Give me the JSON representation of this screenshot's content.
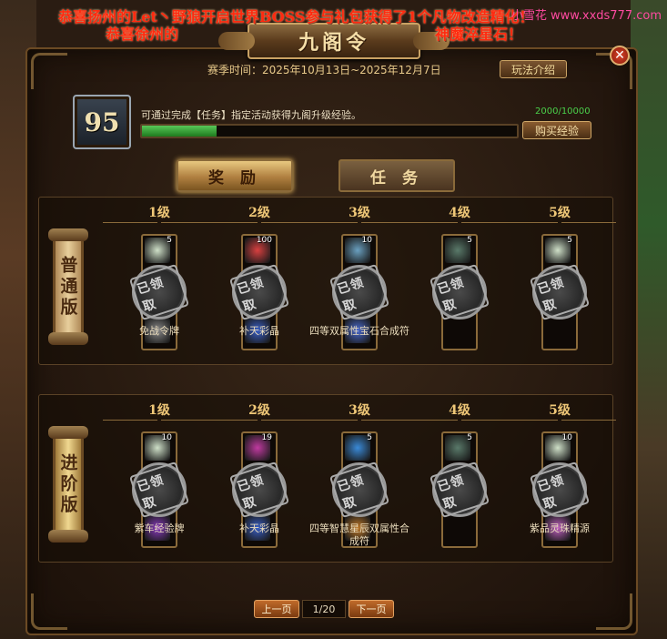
{
  "broadcast": {
    "line1": "恭喜扬州的Let丶野狼开启世界BOSS参与礼包获得了1个凡物改造精化！",
    "line2": "恭喜徐州的",
    "line2_tail": "神魔淬星石！"
  },
  "watermark": "小雪花 www.xxds777.com",
  "title": "九阁令",
  "season": "赛季时间：2025年10月13日~2025年12月7日",
  "rules_button": "玩法介绍",
  "level": "95",
  "upgrade_desc": "可通过完成【任务】指定活动获得九阁升级经验。",
  "exp": {
    "text": "2000/10000",
    "fraction": 0.2
  },
  "buy_button": "购买经验",
  "tabs": {
    "reward": "奖 励",
    "task": "任 务"
  },
  "tiers": [
    "1级",
    "2级",
    "3级",
    "4级",
    "5级"
  ],
  "claimed_label": "已领取",
  "normal": {
    "label": "普通版",
    "cards": [
      {
        "count": "5",
        "top_color": "#cfe0c8",
        "bot_color": "#8a8a8a",
        "name": "免战令牌"
      },
      {
        "count": "100",
        "top_color": "#d84040",
        "bot_color": "#3a60c8",
        "name": "补天彩晶"
      },
      {
        "count": "10",
        "top_color": "#6aa0c0",
        "bot_color": "#4a6ad0",
        "name": "四等双属性宝石合成符"
      },
      {
        "count": "5",
        "top_color": "#5a7a6a",
        "bot_color": "",
        "name": ""
      },
      {
        "count": "5",
        "top_color": "#cfe0c8",
        "bot_color": "",
        "name": ""
      }
    ]
  },
  "advanced": {
    "label": "进阶版",
    "cards": [
      {
        "count": "10",
        "top_color": "#cfe0c8",
        "bot_color": "#8a3ac0",
        "name": "紫车经验牌"
      },
      {
        "count": "19",
        "top_color": "#c03aa0",
        "bot_color": "#3a60c8",
        "name": "补天彩晶"
      },
      {
        "count": "5",
        "top_color": "#3a8ad8",
        "bot_color": "#c07a2a",
        "name": "四等智慧星辰双属性合成符"
      },
      {
        "count": "5",
        "top_color": "#5a7a6a",
        "bot_color": "",
        "name": ""
      },
      {
        "count": "10",
        "top_color": "#cfe0c8",
        "bot_color": "#c060c0",
        "name": "紫品灵珠精源"
      }
    ]
  },
  "pager": {
    "prev": "上一页",
    "info": "1/20",
    "next": "下一页"
  }
}
